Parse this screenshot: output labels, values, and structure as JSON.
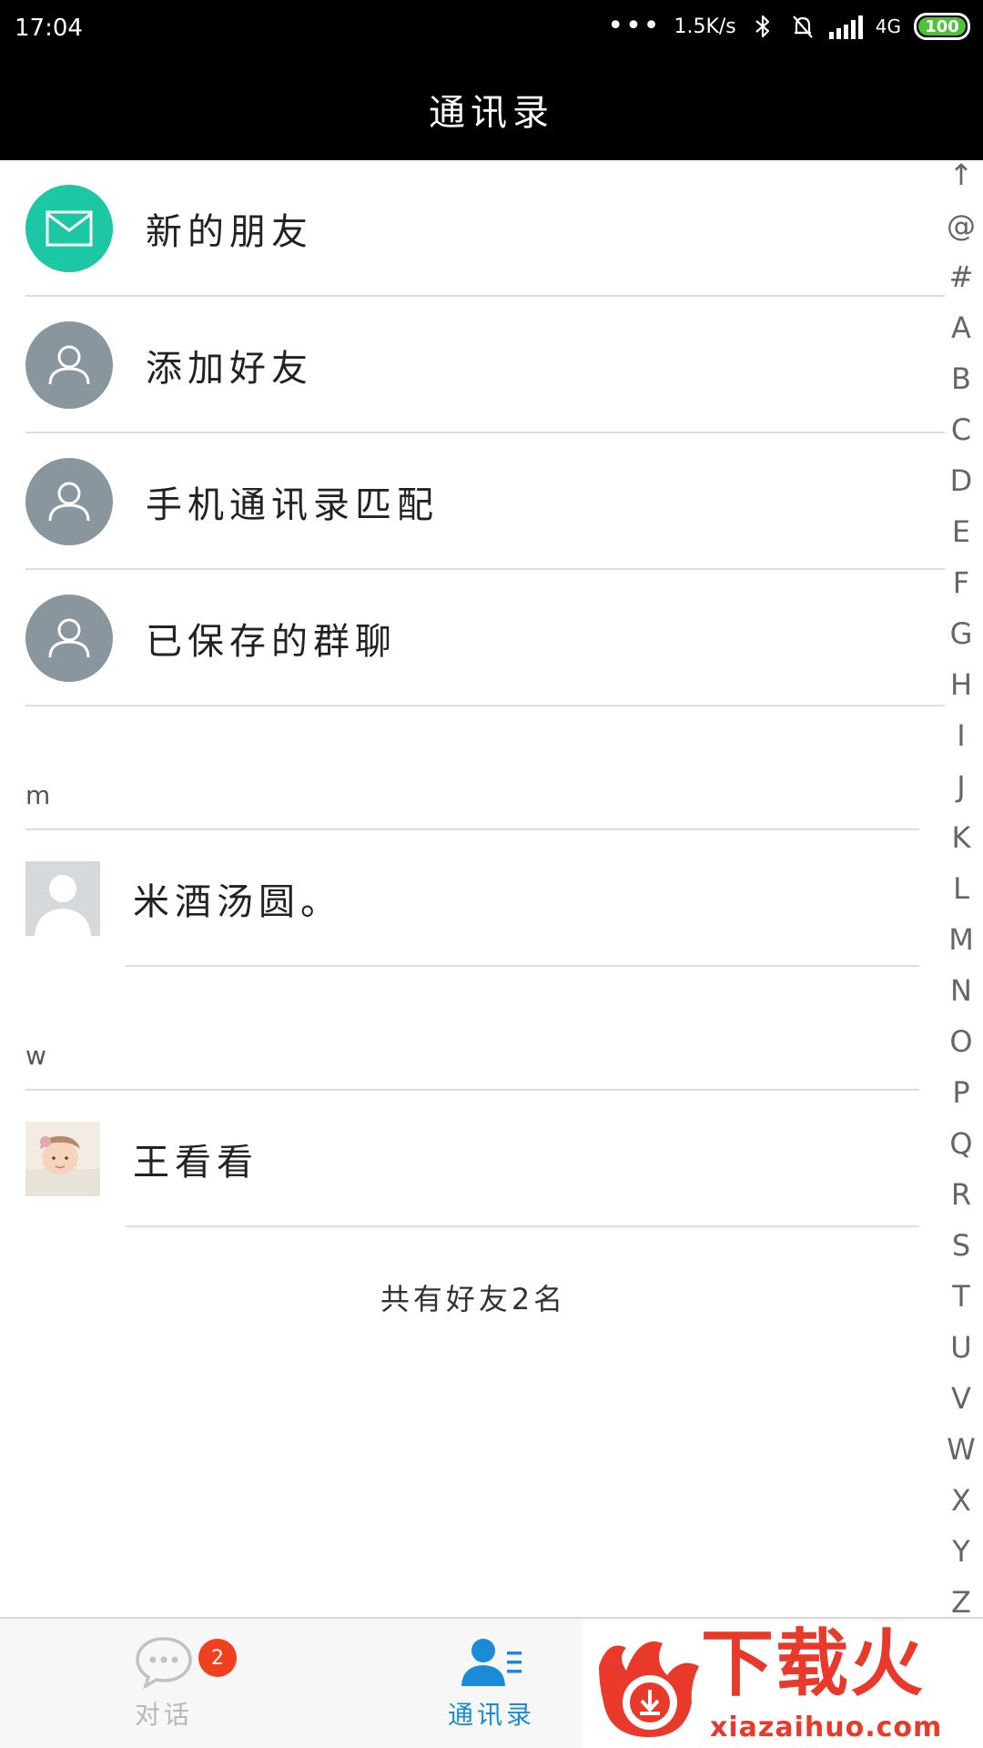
{
  "status_bar": {
    "time": "17:04",
    "dots": "•••",
    "net_speed": "1.5K/s",
    "network": "4G",
    "battery": "100"
  },
  "header": {
    "title": "通讯录"
  },
  "entries": [
    {
      "label": "新的朋友",
      "icon": "mail-icon",
      "color": "#1cc7a6"
    },
    {
      "label": "添加好友",
      "icon": "person-icon",
      "color": "#8a969e"
    },
    {
      "label": "手机通讯录匹配",
      "icon": "person-icon",
      "color": "#8a969e"
    },
    {
      "label": "已保存的群聊",
      "icon": "person-icon",
      "color": "#8a969e"
    }
  ],
  "sections": [
    {
      "letter": "m",
      "contacts": [
        {
          "name": "米酒汤圆。",
          "avatar": "default-avatar"
        }
      ]
    },
    {
      "letter": "w",
      "contacts": [
        {
          "name": "王看看",
          "avatar": "baby-photo-avatar"
        }
      ]
    }
  ],
  "friend_count": "共有好友2名",
  "alpha_index": [
    "↑",
    "@",
    "#",
    "A",
    "B",
    "C",
    "D",
    "E",
    "F",
    "G",
    "H",
    "I",
    "J",
    "K",
    "L",
    "M",
    "N",
    "O",
    "P",
    "Q",
    "R",
    "S",
    "T",
    "U",
    "V",
    "W",
    "X",
    "Y",
    "Z"
  ],
  "tabs": {
    "chat": {
      "label": "对话",
      "badge": "2"
    },
    "contacts": {
      "label": "通讯录",
      "active": true
    }
  },
  "watermark": {
    "title": "下载火",
    "url": "xiazaihuo.com"
  },
  "colors": {
    "accent": "#1a8bd6",
    "teal": "#1cc7a6",
    "gray_icon": "#8a969e",
    "badge": "#f0401f",
    "watermark": "#e8392b"
  }
}
